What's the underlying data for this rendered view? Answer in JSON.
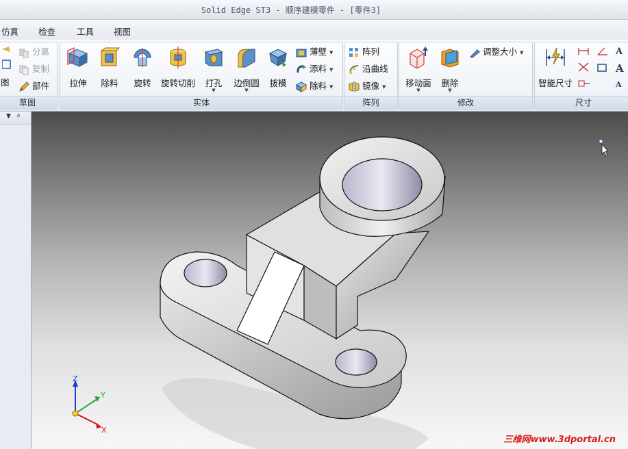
{
  "window": {
    "title": "Solid Edge ST3 - 顺序建模零件 - [零件3]"
  },
  "menu": {
    "items": [
      "仿真",
      "检查",
      "工具",
      "视图"
    ]
  },
  "ribbon": {
    "groups": {
      "sketch": {
        "label": "草图",
        "partial_label": "图",
        "small": [
          "分离",
          "复制",
          "部件"
        ]
      },
      "solids": {
        "label": "实体",
        "big": [
          "拉伸",
          "除料",
          "旋转",
          "旋转切削",
          "打孔",
          "边倒圆",
          "拔模"
        ],
        "small": [
          "薄壁",
          "添料",
          "除料"
        ]
      },
      "pattern": {
        "label": "阵列",
        "small": [
          "阵列",
          "沿曲线",
          "镜像"
        ]
      },
      "modify": {
        "label": "修改",
        "big": [
          "移动面",
          "删除"
        ],
        "small": [
          "调整大小"
        ]
      },
      "dimension": {
        "label": "尺寸",
        "big": [
          "智能尺寸"
        ],
        "text_icon": "A"
      }
    }
  },
  "viewport": {
    "triad": {
      "z": "Z",
      "y": "Y",
      "x": "X"
    },
    "watermark": "三维网www.3dportal.cn"
  },
  "colors": {
    "accent_red": "#d81e1e",
    "triad_blue": "#1a3fd0",
    "triad_green": "#21a83a",
    "triad_red": "#d01a1a"
  }
}
